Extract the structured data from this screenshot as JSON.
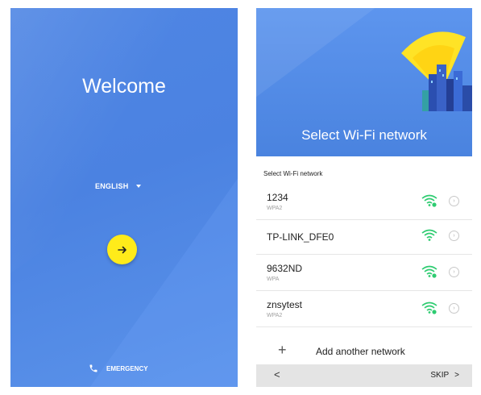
{
  "welcome_screen": {
    "title": "Welcome",
    "language": "ENGLISH",
    "emergency_label": "EMERGENCY",
    "colors": {
      "background": "#4f86e4",
      "fab": "#ffeb1a"
    },
    "icons": {
      "next": "arrow-right-icon",
      "emergency": "phone-icon",
      "language": "caret-down-icon"
    }
  },
  "wifi_screen": {
    "title": "Select Wi-Fi network",
    "list_heading": "Select Wi-Fi network",
    "networks": [
      {
        "name": "1234",
        "security": "WPA2"
      },
      {
        "name": "TP-LINK_DFE0",
        "security": ""
      },
      {
        "name": "9632ND",
        "security": "WPA"
      },
      {
        "name": "znsytest",
        "security": "WPA2"
      }
    ],
    "add_network_label": "Add another network",
    "back_label": "<",
    "skip_label": "SKIP",
    "skip_chevron": ">",
    "colors": {
      "header": "#4a83df",
      "signal": "#2ecc71"
    }
  }
}
